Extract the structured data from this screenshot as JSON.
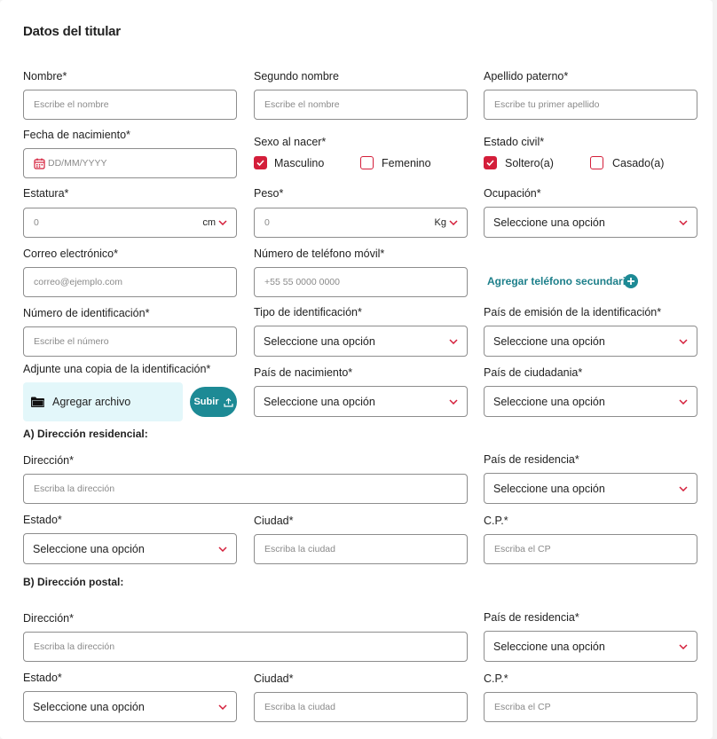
{
  "form": {
    "title": "Datos del titular",
    "nombre": {
      "label": "Nombre*",
      "placeholder": "Escribe el nombre"
    },
    "segundo_nombre": {
      "label": "Segundo nombre",
      "placeholder": "Escribe el nombre"
    },
    "apellido_paterno": {
      "label": "Apellido paterno*",
      "placeholder": "Escribe tu primer apellido"
    },
    "fecha_nacimiento": {
      "label": "Fecha de nacimiento*",
      "placeholder": "DD/MM/YYYY",
      "icon": "calendar-icon"
    },
    "sexo": {
      "label": "Sexo al nacer*",
      "options": [
        {
          "label": "Masculino",
          "checked": true
        },
        {
          "label": "Femenino",
          "checked": false
        }
      ]
    },
    "estado_civil": {
      "label": "Estado civil*",
      "options": [
        {
          "label": "Soltero(a)",
          "checked": true
        },
        {
          "label": "Casado(a)",
          "checked": false
        }
      ]
    },
    "estatura": {
      "label": "Estatura*",
      "value": "0",
      "unit": "cm"
    },
    "peso": {
      "label": "Peso*",
      "value": "0",
      "unit": "Kg"
    },
    "ocupacion": {
      "label": "Ocupación*",
      "value": "Seleccione una opción"
    },
    "correo": {
      "label": "Correo electrónico*",
      "placeholder": "correo@ejemplo.com"
    },
    "telefono": {
      "label": "Número de teléfono móvil*",
      "placeholder": "+55 55 0000 0000"
    },
    "agregar_telefono": "Agregar teléfono secundario",
    "num_identificacion": {
      "label": "Número de identificación*",
      "placeholder": "Escribe el número"
    },
    "tipo_identificacion": {
      "label": "Tipo de identificación*",
      "value": "Seleccione una opción"
    },
    "pais_emision": {
      "label": "País de emisión de la identificación*",
      "value": "Seleccione una opción"
    },
    "adjunte": {
      "label": "Adjunte una copia de la identificación*",
      "upload_label": "Agregar archivo",
      "submit_label": "Subir"
    },
    "pais_nacimiento": {
      "label": "País de nacimiento*",
      "value": "Seleccione una opción"
    },
    "pais_ciudadania": {
      "label": "País de ciudadania*",
      "value": "Seleccione una opción"
    }
  },
  "residencial": {
    "section_title": "A) Dirección residencial:",
    "direccion": {
      "label": "Dirección*",
      "placeholder": "Escriba la dirección"
    },
    "pais_residencia": {
      "label": "País de residencia*",
      "value": "Seleccione una opción"
    },
    "estado": {
      "label": "Estado*",
      "value": "Seleccione una opción"
    },
    "ciudad": {
      "label": "Ciudad*",
      "placeholder": "Escriba la ciudad"
    },
    "cp": {
      "label": "C.P.*",
      "placeholder": "Escriba el CP"
    }
  },
  "postal": {
    "section_title": "B) Dirección postal:",
    "direccion": {
      "label": "Dirección*",
      "placeholder": "Escriba la dirección"
    },
    "pais_residencia": {
      "label": "País de residencia*",
      "value": "Seleccione una opción"
    },
    "estado": {
      "label": "Estado*",
      "value": "Seleccione una opción"
    },
    "ciudad": {
      "label": "Ciudad*",
      "placeholder": "Escriba la ciudad"
    },
    "cp": {
      "label": "C.P.*",
      "placeholder": "Escriba el CP"
    }
  },
  "colors": {
    "accent_red": "#d41e3a",
    "teal": "#1d8a95",
    "upload_bg": "#e3f7fa",
    "border": "#8d8d8d"
  }
}
